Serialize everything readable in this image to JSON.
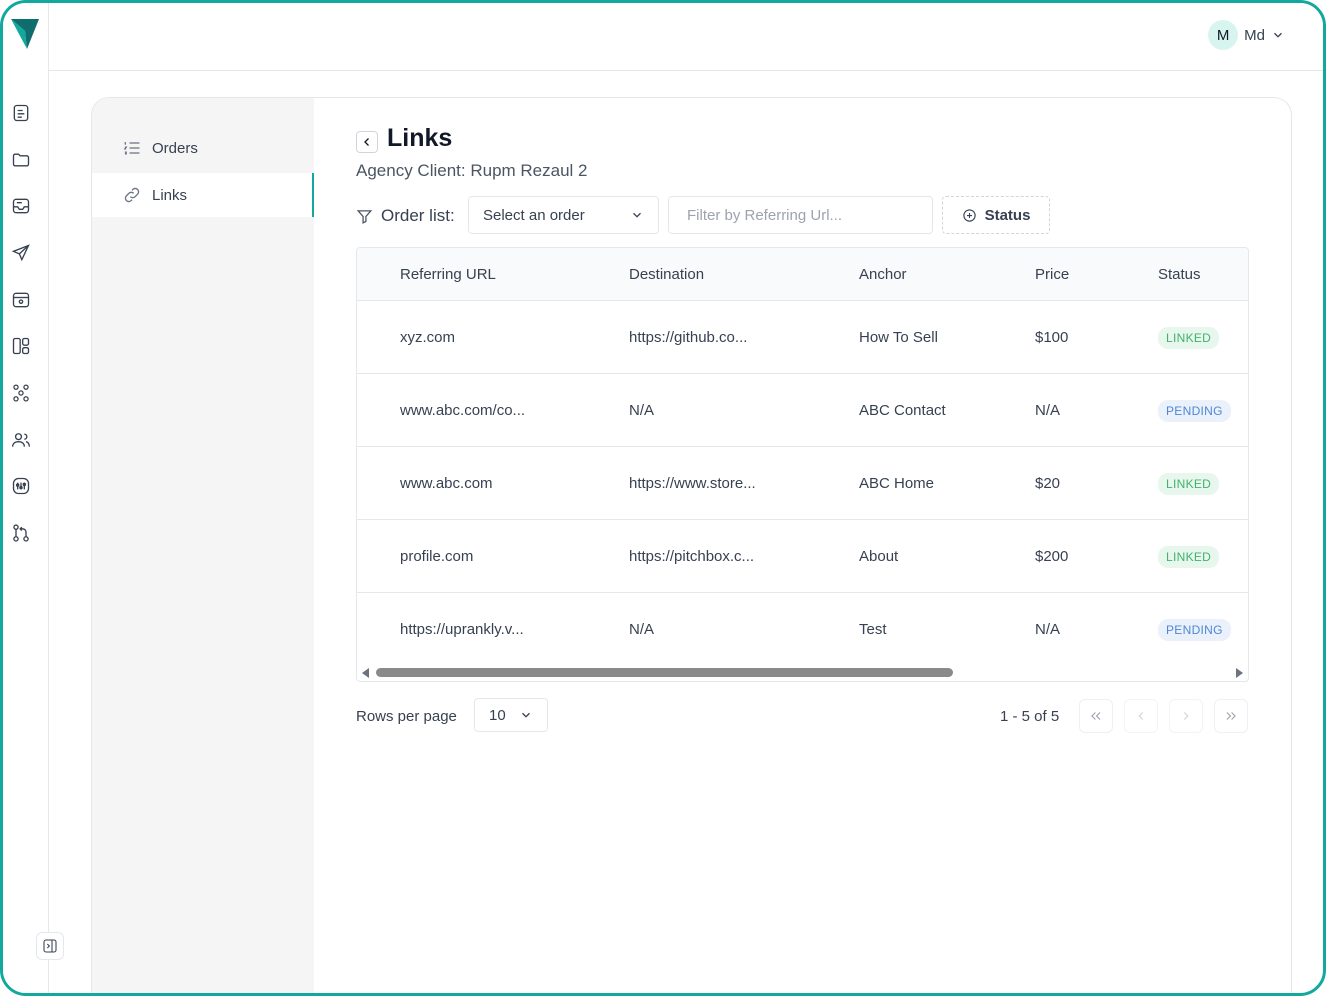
{
  "header": {
    "user_initial": "M",
    "user_name": "Md"
  },
  "rail": {
    "icons": [
      "document-icon",
      "folder-icon",
      "inbox-icon",
      "send-icon",
      "box-icon",
      "layout-icon",
      "network-icon",
      "users-icon",
      "settings-icon",
      "git-branch-icon"
    ]
  },
  "subnav": {
    "items": [
      {
        "label": "Orders"
      },
      {
        "label": "Links"
      }
    ],
    "active": "Links"
  },
  "page": {
    "title": "Links",
    "subtitle": "Agency Client: Rupm Rezaul 2"
  },
  "filters": {
    "order_label": "Order list:",
    "order_select": "Select an order",
    "ref_placeholder": "Filter by Referring Url...",
    "status_label": "Status"
  },
  "table": {
    "columns": [
      "Referring URL",
      "Destination",
      "Anchor",
      "Price",
      "Status"
    ],
    "rows": [
      {
        "referring": "xyz.com",
        "destination": "https://github.co...",
        "anchor": "How To Sell",
        "price": "$100",
        "status": "LINKED"
      },
      {
        "referring": "www.abc.com/co...",
        "destination": "N/A",
        "anchor": "ABC Contact",
        "price": "N/A",
        "status": "PENDING"
      },
      {
        "referring": "www.abc.com",
        "destination": "https://www.store...",
        "anchor": "ABC Home",
        "price": "$20",
        "status": "LINKED"
      },
      {
        "referring": "profile.com",
        "destination": "https://pitchbox.c...",
        "anchor": "About",
        "price": "$200",
        "status": "LINKED"
      },
      {
        "referring": "https://uprankly.v...",
        "destination": "N/A",
        "anchor": "Test",
        "price": "N/A",
        "status": "PENDING"
      }
    ]
  },
  "pagination": {
    "rows_label": "Rows per page",
    "rows_value": "10",
    "range": "1 - 5 of 5"
  },
  "colors": {
    "accent": "#13a89e",
    "linked_bg": "#e8f7ee",
    "linked_fg": "#3fb36b",
    "pending_bg": "#eaf1fb",
    "pending_fg": "#4f86d6"
  }
}
